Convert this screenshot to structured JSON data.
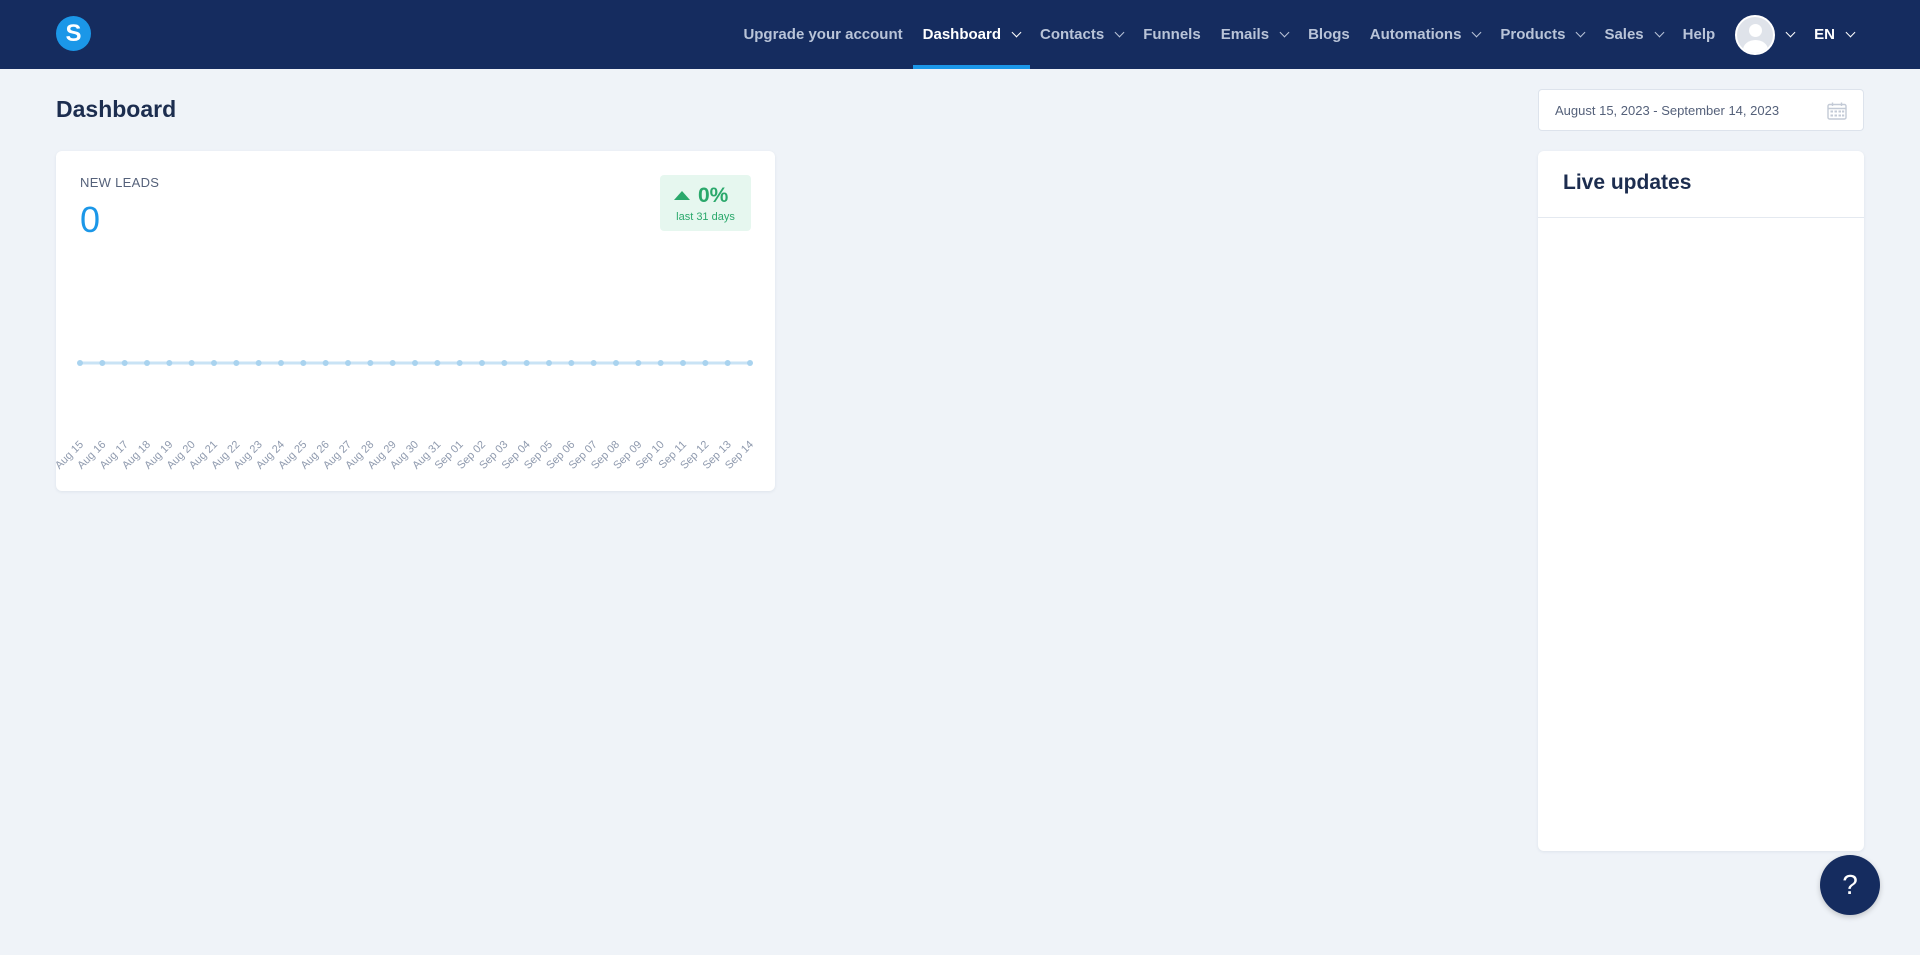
{
  "nav": {
    "logo_letter": "S",
    "items": [
      {
        "label": "Upgrade your account",
        "dropdown": false,
        "active": false
      },
      {
        "label": "Dashboard",
        "dropdown": true,
        "active": true
      },
      {
        "label": "Contacts",
        "dropdown": true,
        "active": false
      },
      {
        "label": "Funnels",
        "dropdown": false,
        "active": false
      },
      {
        "label": "Emails",
        "dropdown": true,
        "active": false
      },
      {
        "label": "Blogs",
        "dropdown": false,
        "active": false
      },
      {
        "label": "Automations",
        "dropdown": true,
        "active": false
      },
      {
        "label": "Products",
        "dropdown": true,
        "active": false
      },
      {
        "label": "Sales",
        "dropdown": true,
        "active": false
      },
      {
        "label": "Help",
        "dropdown": false,
        "active": false
      }
    ],
    "language": "EN",
    "user_icon": "user-avatar-icon"
  },
  "page": {
    "title": "Dashboard",
    "date_range": "August 15, 2023 - September 14, 2023",
    "date_icon": "calendar-icon"
  },
  "new_leads": {
    "label": "NEW LEADS",
    "value": "0",
    "change": "0%",
    "change_period": "last 31 days",
    "change_icon": "arrow-up-icon"
  },
  "chart_data": {
    "type": "line",
    "categories": [
      "Aug 15",
      "Aug 16",
      "Aug 17",
      "Aug 18",
      "Aug 19",
      "Aug 20",
      "Aug 21",
      "Aug 22",
      "Aug 23",
      "Aug 24",
      "Aug 25",
      "Aug 26",
      "Aug 27",
      "Aug 28",
      "Aug 29",
      "Aug 30",
      "Aug 31",
      "Sep 01",
      "Sep 02",
      "Sep 03",
      "Sep 04",
      "Sep 05",
      "Sep 06",
      "Sep 07",
      "Sep 08",
      "Sep 09",
      "Sep 10",
      "Sep 11",
      "Sep 12",
      "Sep 13",
      "Sep 14"
    ],
    "values": [
      0,
      0,
      0,
      0,
      0,
      0,
      0,
      0,
      0,
      0,
      0,
      0,
      0,
      0,
      0,
      0,
      0,
      0,
      0,
      0,
      0,
      0,
      0,
      0,
      0,
      0,
      0,
      0,
      0,
      0,
      0
    ],
    "title": "",
    "xlabel": "",
    "ylabel": "",
    "grid": false,
    "colors": {
      "line": "#c9e3f5",
      "point": "#a9d3ef",
      "label": "#8f9aae"
    }
  },
  "live_updates": {
    "title": "Live updates"
  },
  "help_button": {
    "label": "?"
  },
  "colors": {
    "topbar": "#152c5f",
    "accent": "#1b97e8",
    "background": "#eff3f8",
    "success": "#2aa86b"
  }
}
